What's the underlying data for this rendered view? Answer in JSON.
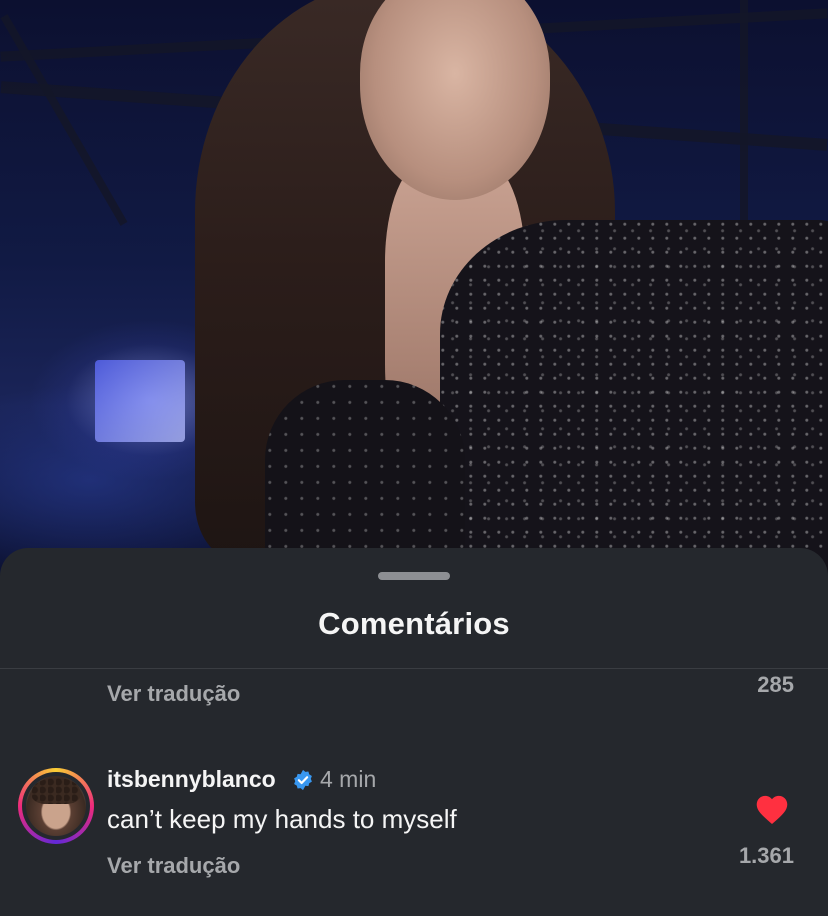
{
  "sheet": {
    "title": "Comentários"
  },
  "previous_comment": {
    "translate_label": "Ver tradução",
    "like_count": "285"
  },
  "comment": {
    "username": "itsbennyblanco",
    "verified": true,
    "time": "4 min",
    "text": "can’t keep my hands to myself",
    "translate_label": "Ver tradução",
    "liked": true,
    "like_count": "1.361"
  },
  "colors": {
    "sheet_background": "#25282d",
    "primary_text": "#f5f5f5",
    "secondary_text": "#a6a8ab",
    "verified_badge": "#3897f0",
    "like_heart": "#ff3040"
  },
  "icons": {
    "verified": "verified-badge-icon",
    "like": "heart-icon"
  }
}
